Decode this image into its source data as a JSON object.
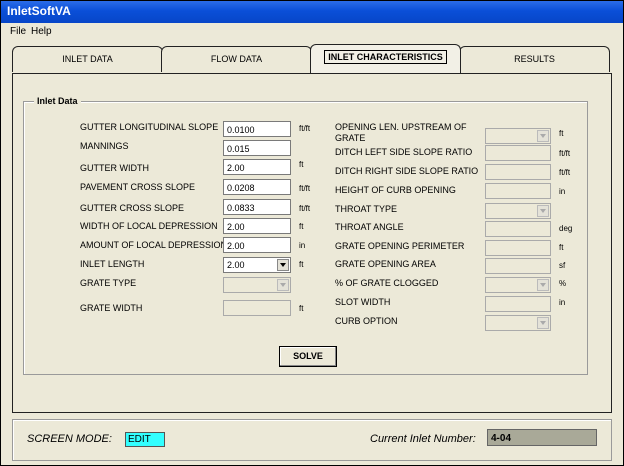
{
  "window": {
    "title": "InletSoftVA"
  },
  "menu": [
    "File",
    "Help"
  ],
  "tabs": [
    {
      "label": "INLET DATA",
      "active": false
    },
    {
      "label": "FLOW DATA",
      "active": false
    },
    {
      "label": "INLET CHARACTERISTICS",
      "active": true
    },
    {
      "label": "RESULTS",
      "active": false
    }
  ],
  "group_title": "Inlet Data",
  "left_fields": [
    {
      "label": "GUTTER LONGITUDINAL SLOPE",
      "value": "0.0100",
      "unit": "ft/ft",
      "type": "text"
    },
    {
      "label": "MANNINGS",
      "value": "0.015",
      "unit": "",
      "type": "text"
    },
    {
      "label": "GUTTER WIDTH",
      "value": "2.00",
      "unit": "ft",
      "type": "text"
    },
    {
      "label": "PAVEMENT CROSS SLOPE",
      "value": "0.0208",
      "unit": "ft/ft",
      "type": "text"
    },
    {
      "label": "GUTTER CROSS SLOPE",
      "value": "0.0833",
      "unit": "ft/ft",
      "type": "text"
    },
    {
      "label": "WIDTH OF LOCAL DEPRESSION",
      "value": "2.00",
      "unit": "ft",
      "type": "text"
    },
    {
      "label": "AMOUNT OF LOCAL DEPRESSION",
      "value": "2.00",
      "unit": "in",
      "type": "text"
    },
    {
      "label": "INLET LENGTH",
      "value": "2.00",
      "unit": "ft",
      "type": "combo"
    },
    {
      "label": "GRATE TYPE",
      "value": "",
      "unit": "",
      "type": "combo-disabled"
    },
    {
      "label": "GRATE WIDTH",
      "value": "",
      "unit": "ft",
      "type": "disabled"
    }
  ],
  "right_fields": [
    {
      "label1": "OPENING LEN. UPSTREAM OF",
      "label2": "GRATE",
      "value": "",
      "unit": "ft",
      "type": "combo-disabled"
    },
    {
      "label1": "DITCH LEFT SIDE SLOPE RATIO",
      "value": "",
      "unit": "ft/ft",
      "type": "disabled"
    },
    {
      "label1": "DITCH RIGHT SIDE SLOPE RATIO",
      "value": "",
      "unit": "ft/ft",
      "type": "disabled"
    },
    {
      "label1": "HEIGHT OF CURB OPENING",
      "value": "",
      "unit": "in",
      "type": "disabled"
    },
    {
      "label1": "THROAT TYPE",
      "value": "",
      "unit": "",
      "type": "combo-disabled"
    },
    {
      "label1": "THROAT ANGLE",
      "value": "",
      "unit": "deg",
      "type": "disabled"
    },
    {
      "label1": "GRATE OPENING PERIMETER",
      "value": "",
      "unit": "ft",
      "type": "disabled"
    },
    {
      "label1": "GRATE OPENING AREA",
      "value": "",
      "unit": "sf",
      "type": "disabled"
    },
    {
      "label1": "% OF GRATE CLOGGED",
      "value": "",
      "unit": "%",
      "type": "combo-disabled"
    },
    {
      "label1": "SLOT WIDTH",
      "value": "",
      "unit": "in",
      "type": "disabled"
    },
    {
      "label1": "CURB OPTION",
      "value": "",
      "unit": "",
      "type": "combo-disabled"
    }
  ],
  "solve_label": "SOLVE",
  "status": {
    "mode_label": "SCREEN MODE:",
    "mode_value": "EDIT",
    "current_label": "Current Inlet Number:",
    "current_value": "4-04"
  }
}
